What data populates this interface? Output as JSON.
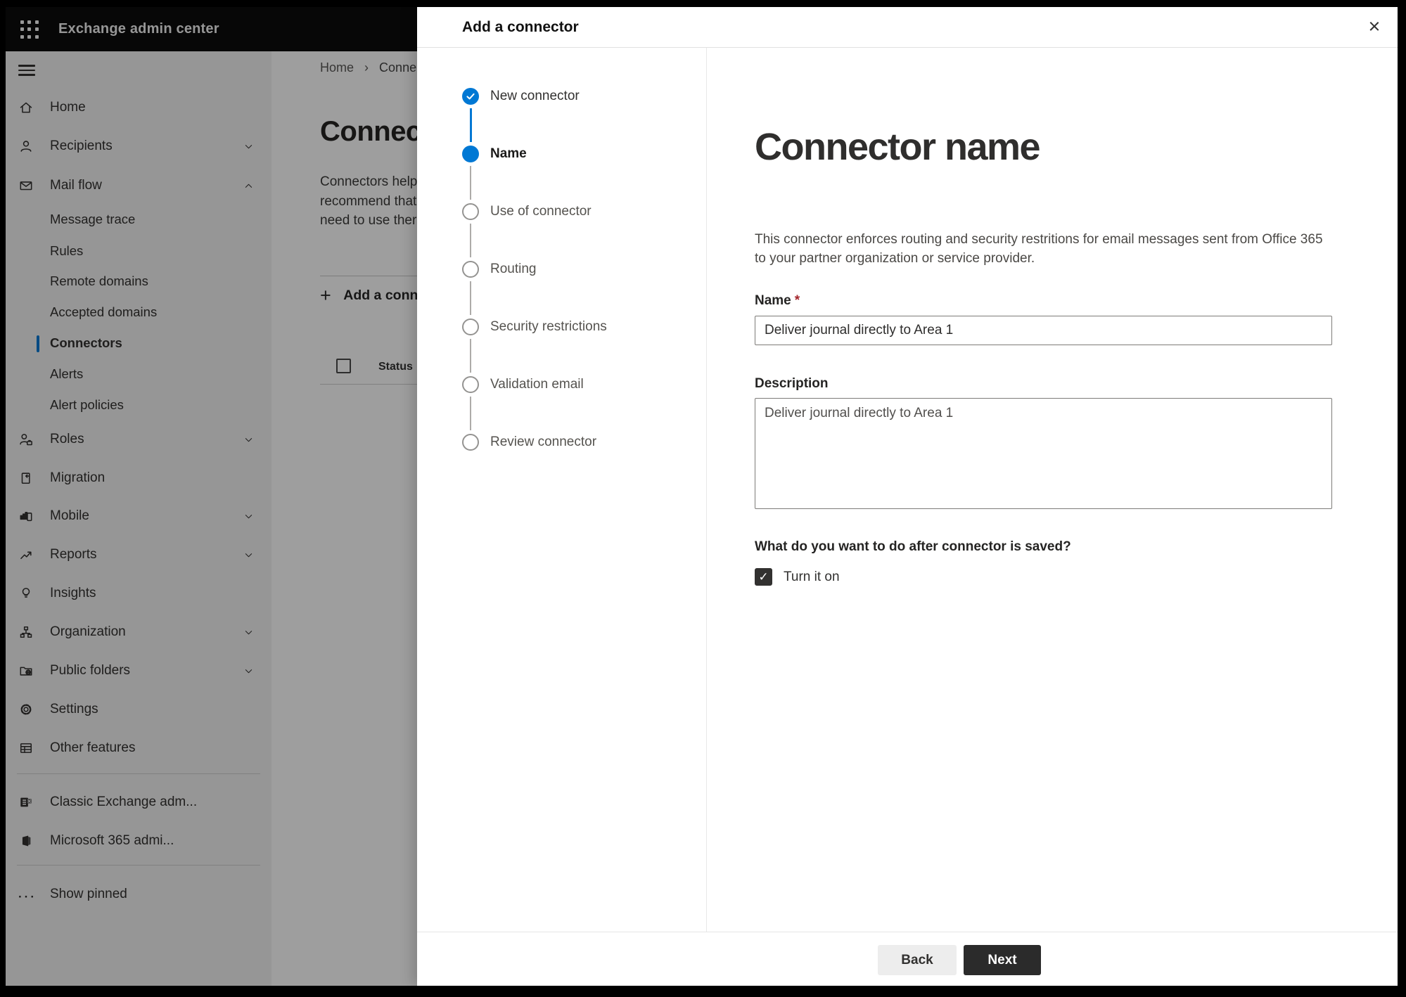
{
  "topbar": {
    "title": "Exchange admin center"
  },
  "icons": {
    "close": "×",
    "add": "+",
    "breadcrumb_sep": "›",
    "check": "✓",
    "more": "···"
  },
  "sidebar": {
    "items": [
      {
        "type": "item",
        "level": 1,
        "icon": "home",
        "label": "Home"
      },
      {
        "type": "item",
        "level": 1,
        "icon": "person",
        "label": "Recipients",
        "chevron": "down"
      },
      {
        "type": "item",
        "level": 1,
        "icon": "mail",
        "label": "Mail flow",
        "chevron": "up"
      },
      {
        "type": "item",
        "level": 2,
        "label": "Message trace"
      },
      {
        "type": "item",
        "level": 2,
        "label": "Rules"
      },
      {
        "type": "item",
        "level": 2,
        "label": "Remote domains"
      },
      {
        "type": "item",
        "level": 2,
        "label": "Accepted domains"
      },
      {
        "type": "item",
        "level": 2,
        "label": "Connectors",
        "selected": true
      },
      {
        "type": "item",
        "level": 2,
        "label": "Alerts"
      },
      {
        "type": "item",
        "level": 2,
        "label": "Alert policies"
      },
      {
        "type": "item",
        "level": 1,
        "icon": "roles",
        "label": "Roles",
        "chevron": "down"
      },
      {
        "type": "item",
        "level": 1,
        "icon": "migration",
        "label": "Migration"
      },
      {
        "type": "item",
        "level": 1,
        "icon": "mobile",
        "label": "Mobile",
        "chevron": "down"
      },
      {
        "type": "item",
        "level": 1,
        "icon": "reports",
        "label": "Reports",
        "chevron": "down"
      },
      {
        "type": "item",
        "level": 1,
        "icon": "insights",
        "label": "Insights"
      },
      {
        "type": "item",
        "level": 1,
        "icon": "organization",
        "label": "Organization",
        "chevron": "down"
      },
      {
        "type": "item",
        "level": 1,
        "icon": "public-folders",
        "label": "Public folders",
        "chevron": "down"
      },
      {
        "type": "item",
        "level": 1,
        "icon": "settings",
        "label": "Settings"
      },
      {
        "type": "item",
        "level": 1,
        "icon": "other-features",
        "label": "Other features"
      },
      {
        "type": "divider"
      },
      {
        "type": "item",
        "level": 1,
        "icon": "classic-exchange",
        "label": "Classic Exchange adm..."
      },
      {
        "type": "item",
        "level": 1,
        "icon": "m365",
        "label": "Microsoft 365 admi..."
      },
      {
        "type": "divider"
      },
      {
        "type": "item",
        "level": 1,
        "icon": "more",
        "label": "Show pinned"
      }
    ]
  },
  "page": {
    "breadcrumb": {
      "home": "Home",
      "current": "Conne"
    },
    "title": "Connec",
    "body_lines": [
      "Connectors help",
      "recommend that",
      "need to use ther"
    ],
    "add_button_label": "Add a conn",
    "table": {
      "status_header": "Status"
    }
  },
  "dialog": {
    "title": "Add a connector",
    "steps": [
      {
        "label": "New connector",
        "state": "done"
      },
      {
        "label": "Name",
        "state": "current"
      },
      {
        "label": "Use of connector",
        "state": "todo"
      },
      {
        "label": "Routing",
        "state": "todo"
      },
      {
        "label": "Security restrictions",
        "state": "todo"
      },
      {
        "label": "Validation email",
        "state": "todo"
      },
      {
        "label": "Review connector",
        "state": "todo"
      }
    ],
    "content": {
      "heading": "Connector name",
      "intro_lines": [
        "This connector enforces routing and security restritions for email messages sent from Office 365",
        "to your partner organization or service provider."
      ],
      "name_label": "Name",
      "name_required_mark": "*",
      "name_value": "Deliver journal directly to Area 1",
      "description_label": "Description",
      "description_value": "Deliver journal directly to Area 1",
      "question": "What do you want to do after connector is saved?",
      "checkbox_label": "Turn it on",
      "checkbox_checked": true
    },
    "footer": {
      "back": "Back",
      "next": "Next"
    }
  },
  "colors": {
    "accent": "#0078d4",
    "topbar": "#0c0c0c",
    "primary_button": "#2b2b2b",
    "required": "#a4262c"
  }
}
